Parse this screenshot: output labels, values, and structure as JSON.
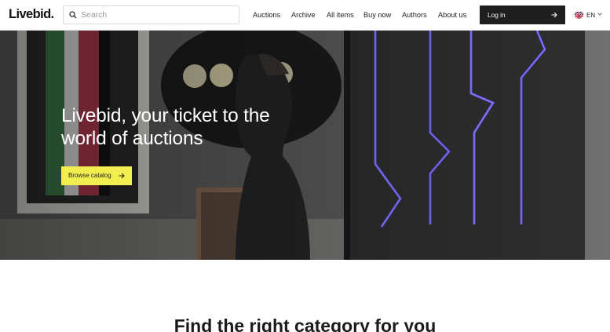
{
  "header": {
    "logo": "Livebid.",
    "search": {
      "placeholder": "Search",
      "value": ""
    },
    "nav": [
      "Auctions",
      "Archive",
      "All items",
      "Buy now",
      "Authors",
      "About us"
    ],
    "login_label": "Log in",
    "language": "EN"
  },
  "hero": {
    "title": "Livebid, your ticket to the world of auctions",
    "cta_label": "Browse catalog"
  },
  "section": {
    "title": "Find the right category for you"
  },
  "colors": {
    "cta_bg": "#f3ee4f",
    "login_bg": "#1f1f1f",
    "neon": "#6b5cff"
  },
  "icons": [
    "search-icon",
    "arrow-right-icon",
    "uk-flag-icon",
    "chevron-down-icon"
  ]
}
